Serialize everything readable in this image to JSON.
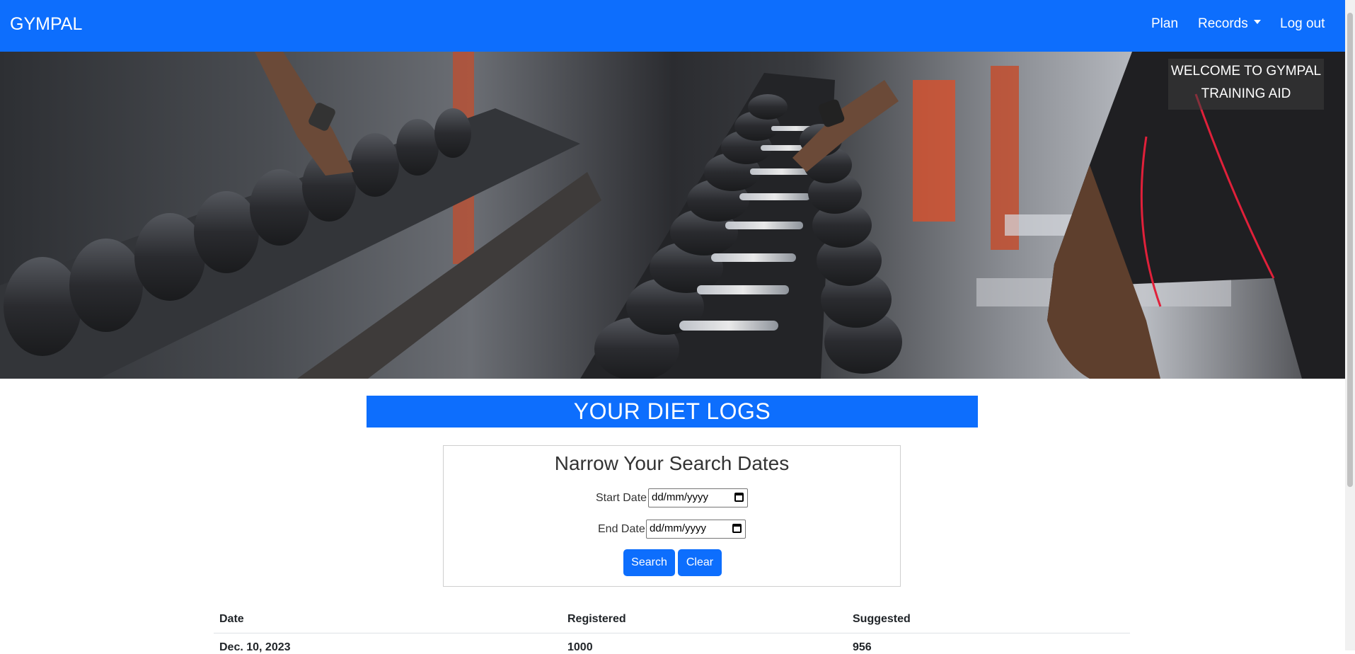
{
  "navbar": {
    "brand": "GYMPAL",
    "items": [
      {
        "label": "Plan"
      },
      {
        "label": "Records"
      },
      {
        "label": "Log out"
      }
    ],
    "bg_color": "#0d6efd"
  },
  "hero": {
    "welcome_line1": "WELCOME TO GYMPAL",
    "welcome_line2": "TRAINING AID"
  },
  "page_title": "YOUR DIET LOGS",
  "search": {
    "title": "Narrow Your Search Dates",
    "start_label": "Start Date",
    "start_value": "dd/mm/yyyy",
    "end_label": "End Date",
    "end_value": "dd/mm/yyyy",
    "search_button": "Search",
    "clear_button": "Clear"
  },
  "table": {
    "headers": [
      "Date",
      "Registered",
      "Suggested"
    ],
    "rows": [
      [
        "Dec. 10, 2023",
        "1000",
        "956"
      ]
    ]
  }
}
